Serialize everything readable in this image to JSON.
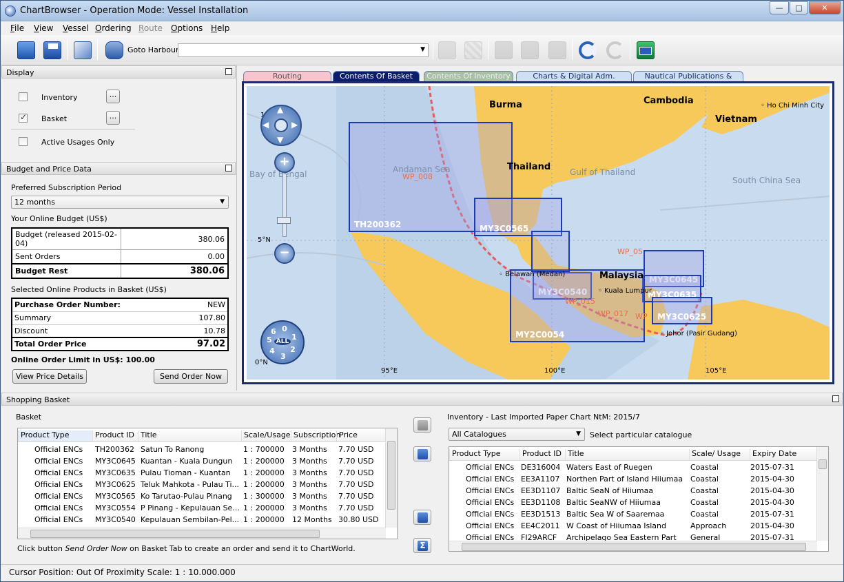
{
  "window": {
    "title": "ChartBrowser - Operation Mode: Vessel Installation"
  },
  "menu": [
    {
      "label": "File",
      "u": "F",
      "rest": "ile",
      "disabled": false
    },
    {
      "label": "View",
      "u": "V",
      "rest": "iew",
      "disabled": false
    },
    {
      "label": "Vessel",
      "u": "V",
      "rest": "essel",
      "disabled": false
    },
    {
      "label": "Ordering",
      "u": "O",
      "rest": "rdering",
      "disabled": false
    },
    {
      "label": "Route",
      "u": "R",
      "rest": "oute",
      "disabled": true
    },
    {
      "label": "Options",
      "u": "O",
      "rest": "ptions",
      "disabled": false
    },
    {
      "label": "Help",
      "u": "H",
      "rest": "elp",
      "disabled": false
    }
  ],
  "toolbar": {
    "goto_label": "Goto Harbour:",
    "goto_value": "",
    "icons": [
      "open-folder-icon",
      "save-icon",
      "catalogue-icon",
      "binoculars-icon",
      "route-grid-icon",
      "route-check-icon",
      "pointer-icon",
      "basket-add-icon",
      "basket-check-icon",
      "refresh-icon",
      "refresh-disabled-icon",
      "email-icon"
    ]
  },
  "display": {
    "header": "Display",
    "inventory_label": "Inventory",
    "inventory_checked": false,
    "basket_label": "Basket",
    "basket_checked": true,
    "active_label": "Active Usages Only",
    "active_checked": false,
    "more_label": "..."
  },
  "budget": {
    "header": "Budget and Price Data",
    "sub_period_label": "Preferred Subscription Period",
    "sub_period_value": "12 months",
    "online_budget_label": "Your Online Budget (US$)",
    "rows": [
      {
        "label": "Budget (released 2015-02-04)",
        "value": "380.06"
      },
      {
        "label": "Sent Orders",
        "value": "0.00"
      }
    ],
    "rest_label": "Budget Rest",
    "rest_value": "380.06",
    "selected_label": "Selected Online Products in Basket (US$)",
    "po_label": "Purchase Order Number:",
    "po_value": "NEW",
    "summary_label": "Summary",
    "summary_value": "107.80",
    "discount_label": "Discount",
    "discount_value": "10.78",
    "total_label": "Total Order Price",
    "total_value": "97.02",
    "limit_text": "Online Order Limit in US$: 100.00",
    "view_price_btn": "View Price Details",
    "send_order_btn": "Send Order Now"
  },
  "tabs": [
    {
      "label": "Routing",
      "bg": "#f6c6d0",
      "color": "#555"
    },
    {
      "label": "Contents Of Basket",
      "bg": "#0d1d6e",
      "color": "#ffffff"
    },
    {
      "label": "Contents Of Inventory",
      "bg": "#a8c0a8",
      "color": "#eeeeee"
    },
    {
      "label": "Charts & Digital Adm. Products",
      "bg": "#cfe0f5",
      "color": "#1a2a6a"
    },
    {
      "label": "Nautical Publications & Books",
      "bg": "#cfe0f5",
      "color": "#1a2a6a"
    }
  ],
  "map": {
    "places": [
      "Burma",
      "Cambodia",
      "Vietnam",
      "Thailand",
      "Malaysia"
    ],
    "seas": [
      "Andaman Sea",
      "Gulf of Thailand",
      "South China Sea",
      "Bay of Bengal"
    ],
    "cities": [
      "Ho Chi Minh City",
      "Kuala Lumpur",
      "Belawan (Medan)",
      "Johor (Pasir Gudang)"
    ],
    "cells": [
      "TH200362",
      "MY3C0565",
      "MY3C0645",
      "MY3C0635",
      "MY3C0540",
      "MY3C0625",
      "MY2C0054"
    ],
    "waypoints": [
      "WP_008",
      "WP_05",
      "WP_015",
      "WP_017",
      "WP"
    ],
    "coords": [
      "95°E",
      "100°E",
      "105°E",
      "5°N",
      "0°N"
    ],
    "lat_top": "1",
    "levels": [
      "6",
      "0",
      "1",
      "2",
      "3",
      "4",
      "5",
      "ALL"
    ]
  },
  "shopping": {
    "header": "Shopping Basket",
    "basket_label": "Basket",
    "columns": [
      "Product Type",
      "Product ID",
      "Title",
      "Scale/Usage",
      "Subscription",
      "Price"
    ],
    "rows": [
      [
        "Official ENCs",
        "TH200362",
        "Satun To Ranong",
        "1 : 700000",
        "3 Months",
        "7.70 USD"
      ],
      [
        "Official ENCs",
        "MY3C0645",
        "Kuantan - Kuala Dungun",
        "1 : 200000",
        "3 Months",
        "7.70 USD"
      ],
      [
        "Official ENCs",
        "MY3C0635",
        "Pulau Tioman - Kuantan",
        "1 : 200000",
        "3 Months",
        "7.70 USD"
      ],
      [
        "Official ENCs",
        "MY3C0625",
        "Teluk Mahkota - Pulau Ti...",
        "1 : 200000",
        "3 Months",
        "7.70 USD"
      ],
      [
        "Official ENCs",
        "MY3C0565",
        "Ko Tarutao-Pulau Pinang",
        "1 : 300000",
        "3 Months",
        "7.70 USD"
      ],
      [
        "Official ENCs",
        "MY3C0554",
        "P Pinang - Kepulauan Se...",
        "1 : 200000",
        "3 Months",
        "7.70 USD"
      ],
      [
        "Official ENCs",
        "MY3C0540",
        "Kepulauan Sembilan-Pel...",
        "1 : 200000",
        "12 Months",
        "30.80 USD"
      ]
    ],
    "hint_prefix": "Click button ",
    "hint_em": "Send Order Now",
    "hint_suffix": " on Basket Tab to create an order and send it to ChartWorld."
  },
  "inventory": {
    "header": "Inventory  - Last Imported Paper Chart NtM: 2015/7",
    "catalogue_value": "All Catalogues",
    "catalogue_hint": "Select particular catalogue",
    "columns": [
      "Product Type",
      "Product ID",
      "Title",
      "Scale/ Usage",
      "Expiry Date"
    ],
    "rows": [
      [
        "Official ENCs",
        "DE316004",
        "Waters East of Ruegen",
        "Coastal",
        "2015-07-31"
      ],
      [
        "Official ENCs",
        "EE3A1107",
        "Northen Part of Island Hiiumaa",
        "Coastal",
        "2015-04-30"
      ],
      [
        "Official ENCs",
        "EE3D1107",
        "Baltic SeaN of Hiiumaa",
        "Coastal",
        "2015-04-30"
      ],
      [
        "Official ENCs",
        "EE3D1108",
        "Baltic SeaNW of Hiiumaa",
        "Coastal",
        "2015-04-30"
      ],
      [
        "Official ENCs",
        "EE3D1513",
        "Baltic Sea W of Saaremaa",
        "Coastal",
        "2015-07-31"
      ],
      [
        "Official ENCs",
        "EE4C2011",
        "W Coast of Hiiumaa Island",
        "Approach",
        "2015-04-30"
      ],
      [
        "Official ENCs",
        "FI29ARCF",
        "Archipelago Sea Eastern Part",
        "General",
        "2015-07-31"
      ]
    ]
  },
  "status": {
    "text": "Cursor Position:  Out Of Proximity Scale: 1 : 10.000.000"
  }
}
